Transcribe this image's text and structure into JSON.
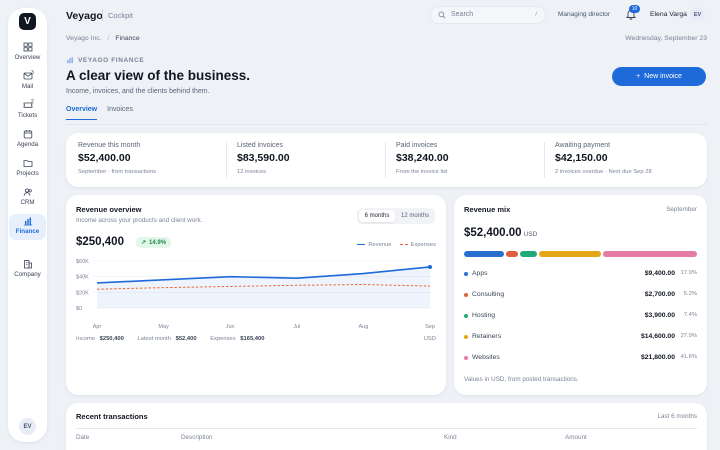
{
  "app": {
    "logo_letter": "V",
    "brand": "Veyago",
    "section": "Cockpit"
  },
  "nav": {
    "items": [
      {
        "label": "Overview",
        "icon": "grid-icon"
      },
      {
        "label": "Mail",
        "icon": "mail-icon",
        "badge": "3"
      },
      {
        "label": "Tickets",
        "icon": "ticket-icon",
        "badge": "2"
      },
      {
        "label": "Agenda",
        "icon": "calendar-icon"
      },
      {
        "label": "Projects",
        "icon": "folder-icon"
      },
      {
        "label": "CRM",
        "icon": "users-icon"
      },
      {
        "label": "Finance",
        "icon": "bar-chart-icon",
        "active": true
      },
      {
        "label": "Company",
        "icon": "building-icon"
      }
    ],
    "avatar": "EV"
  },
  "topbar": {
    "search_placeholder": "Search",
    "search_shortcut": "/",
    "role": "Managing director",
    "notifications": "10",
    "user_name": "Elena Varga",
    "user_initials": "EV"
  },
  "breadcrumb": {
    "root": "Veyago Inc.",
    "separator": "/",
    "current": "Finance"
  },
  "date": "Wednesday, September 23",
  "header": {
    "eyebrow": "VEYAGO FINANCE",
    "title": "A clear view of the business.",
    "subtitle": "Income, invoices, and the clients behind them.",
    "new_invoice": "New invoice",
    "new_invoice_prefix": "+"
  },
  "tabs": [
    "Overview",
    "Invoices"
  ],
  "kpis": [
    {
      "label": "Revenue this month",
      "value": "$52,400.00",
      "note": "September · from transactions"
    },
    {
      "label": "Listed invoices",
      "value": "$83,590.00",
      "note": "12 invoices"
    },
    {
      "label": "Paid invoices",
      "value": "$38,240.00",
      "note": "From the invoice list"
    },
    {
      "label": "Awaiting payment",
      "value": "$42,150.00",
      "note": "2 invoices overdue · Next due Sep 28"
    }
  ],
  "revenue": {
    "title": "Revenue overview",
    "description": "Income across your products and client work.",
    "ranges": [
      "6 months",
      "12 months"
    ],
    "total": "$250,400",
    "delta": "14.9%",
    "delta_arrow": "↗",
    "legend_revenue": "Revenue",
    "legend_expenses": "Expenses",
    "footer": {
      "income_label": "Income",
      "income_value": "$250,400",
      "latest_label": "Latest month",
      "latest_value": "$52,400",
      "expenses_label": "Expenses",
      "expenses_value": "$165,400",
      "currency": "USD"
    }
  },
  "chart_data": {
    "type": "line",
    "categories": [
      "Apr",
      "May",
      "Jun",
      "Jul",
      "Aug",
      "Sep"
    ],
    "yticks": [
      "$60K",
      "$40K",
      "$20K",
      "$0"
    ],
    "ylim": [
      0,
      60000
    ],
    "series": [
      {
        "name": "Revenue",
        "values": [
          32000,
          36000,
          40000,
          38000,
          44000,
          52400
        ],
        "color": "#1e6ad9"
      },
      {
        "name": "Expenses",
        "values": [
          24000,
          26000,
          27500,
          29000,
          30000,
          28000
        ],
        "color": "#e6683a"
      }
    ]
  },
  "mix": {
    "title": "Revenue mix",
    "month": "September",
    "total": "$52,400.00",
    "currency": "USD",
    "items": [
      {
        "name": "Apps",
        "amount": "$9,400.00",
        "pct": "17.9%",
        "share": 17.9,
        "color": "#2a6fcf"
      },
      {
        "name": "Consulting",
        "amount": "$2,700.00",
        "pct": "5.2%",
        "share": 5.2,
        "color": "#e05f3c"
      },
      {
        "name": "Hosting",
        "amount": "$3,900.00",
        "pct": "7.4%",
        "share": 7.4,
        "color": "#22a97a"
      },
      {
        "name": "Retainers",
        "amount": "$14,600.00",
        "pct": "27.9%",
        "share": 27.9,
        "color": "#e3a617"
      },
      {
        "name": "Websites",
        "amount": "$21,800.00",
        "pct": "41.6%",
        "share": 41.6,
        "color": "#e57aa5"
      }
    ],
    "note": "Values in USD, from posted transactions."
  },
  "transactions": {
    "title": "Recent transactions",
    "range": "Last 6 months",
    "columns": [
      "Date",
      "Description",
      "Kind",
      "Amount"
    ]
  }
}
